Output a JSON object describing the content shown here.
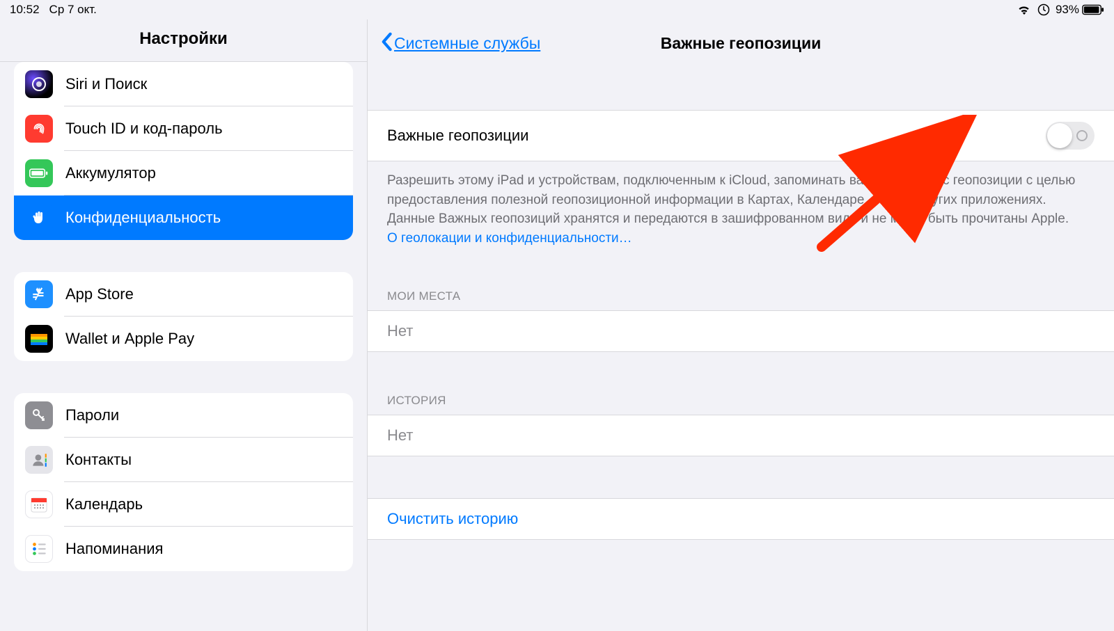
{
  "status": {
    "time": "10:52",
    "date": "Ср 7 окт.",
    "battery_percent": "93%"
  },
  "sidebar": {
    "title": "Настройки",
    "groups": [
      {
        "items": [
          {
            "label": "Siri и Поиск",
            "icon": "siri-icon",
            "bg": "bg-siri"
          },
          {
            "label": "Touch ID и код-пароль",
            "icon": "fingerprint-icon",
            "bg": "bg-touchid"
          },
          {
            "label": "Аккумулятор",
            "icon": "battery-icon",
            "bg": "bg-battery"
          },
          {
            "label": "Конфиденциальность",
            "icon": "hand-icon",
            "bg": "bg-privacy",
            "selected": true
          }
        ]
      },
      {
        "items": [
          {
            "label": "App Store",
            "icon": "appstore-icon",
            "bg": "bg-appstore"
          },
          {
            "label": "Wallet и Apple Pay",
            "icon": "wallet-icon",
            "bg": "bg-wallet"
          }
        ]
      },
      {
        "items": [
          {
            "label": "Пароли",
            "icon": "key-icon",
            "bg": "bg-passwords"
          },
          {
            "label": "Контакты",
            "icon": "contacts-icon",
            "bg": "bg-contacts"
          },
          {
            "label": "Календарь",
            "icon": "calendar-icon",
            "bg": "bg-calendar"
          },
          {
            "label": "Напоминания",
            "icon": "reminders-icon",
            "bg": "bg-reminders"
          }
        ]
      }
    ]
  },
  "detail": {
    "back_label": "Системные службы",
    "title": "Важные геопозиции",
    "main_toggle": {
      "label": "Важные геопозиции",
      "on": false
    },
    "footer": "Разрешить этому iPad и устройствам, подключенным к iCloud, запоминать важные для Вас геопозиции с целью предоставления полезной геопозиционной информации в Картах, Календаре, Фото и других приложениях. Данные Важных геопозиций хранятся и передаются в зашифрованном виде и не могут быть прочитаны Apple.",
    "footer_link": "О геолокации и конфиденциальности…",
    "section_places": {
      "header": "МОИ МЕСТА",
      "value": "Нет"
    },
    "section_history": {
      "header": "ИСТОРИЯ",
      "value": "Нет"
    },
    "clear_label": "Очистить историю"
  }
}
